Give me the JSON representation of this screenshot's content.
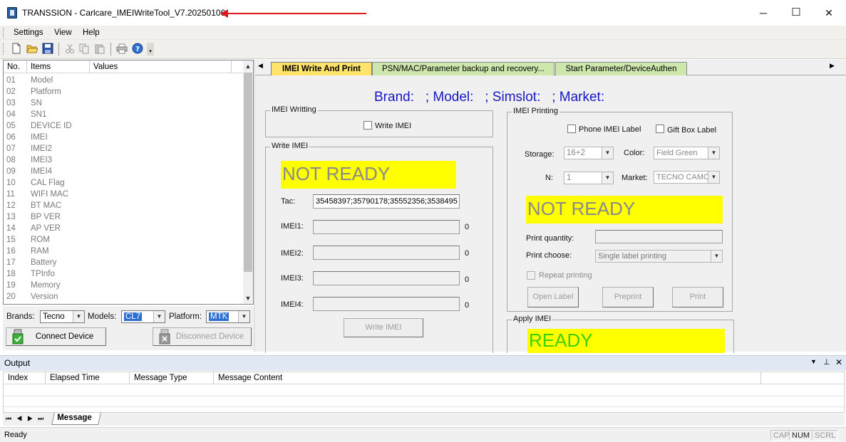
{
  "window": {
    "title": "TRANSSION - Carlcare_IMEIWriteTool_V7.20250106",
    "minimize": "─",
    "maximize": "☐",
    "close": "✕"
  },
  "menu": [
    "Settings",
    "View",
    "Help"
  ],
  "toolbar_icons": [
    "new-file-icon",
    "open-folder-icon",
    "save-icon",
    "cut-icon",
    "copy-icon",
    "paste-icon",
    "print-icon",
    "help-icon"
  ],
  "list": {
    "headers": [
      "No.",
      "Items",
      "Values"
    ],
    "rows": [
      {
        "no": "01",
        "item": "Model"
      },
      {
        "no": "02",
        "item": "Platform"
      },
      {
        "no": "03",
        "item": "SN"
      },
      {
        "no": "04",
        "item": "SN1"
      },
      {
        "no": "05",
        "item": "DEVICE ID"
      },
      {
        "no": "06",
        "item": "IMEI"
      },
      {
        "no": "07",
        "item": "IMEI2"
      },
      {
        "no": "08",
        "item": "IMEI3"
      },
      {
        "no": "09",
        "item": "IMEI4"
      },
      {
        "no": "10",
        "item": "CAL Flag"
      },
      {
        "no": "11",
        "item": "WIFI MAC"
      },
      {
        "no": "12",
        "item": "BT MAC"
      },
      {
        "no": "13",
        "item": "BP VER"
      },
      {
        "no": "14",
        "item": "AP VER"
      },
      {
        "no": "15",
        "item": "ROM"
      },
      {
        "no": "16",
        "item": "RAM"
      },
      {
        "no": "17",
        "item": "Battery"
      },
      {
        "no": "18",
        "item": "TPInfo"
      },
      {
        "no": "19",
        "item": "Memory"
      },
      {
        "no": "20",
        "item": "Version"
      }
    ]
  },
  "device": {
    "brands_label": "Brands:",
    "brands_value": "Tecno",
    "models_label": "Models:",
    "models_value": "CL7",
    "platform_label": "Platform:",
    "platform_value": "MTK",
    "connect": "Connect Device",
    "disconnect": "Disconnect Device"
  },
  "tabs": [
    "IMEI Write And Print",
    "PSN/MAC/Parameter backup and recovery...",
    "Start Parameter/DeviceAuthen"
  ],
  "header_line": "Brand:   ; Model:   ; Simslot:   ; Market:",
  "imei_writing": {
    "group": "IMEI Writting",
    "checkbox": "Write IMEI"
  },
  "write_imei": {
    "group": "Write IMEI",
    "status": "NOT READY",
    "tac_label": "Tac:",
    "tac_value": "35458397;35790178;35552356;3538495",
    "imei_labels": [
      "IMEI1:",
      "IMEI2:",
      "IMEI3:",
      "IMEI4:"
    ],
    "imei_counts": [
      "0",
      "0",
      "0",
      "0"
    ],
    "button": "Write IMEI"
  },
  "imei_printing": {
    "group": "IMEI Printing",
    "phone_label_cb": "Phone IMEI Label",
    "gift_box_cb": "Gift Box Label",
    "storage_label": "Storage:",
    "storage_value": "16+2",
    "color_label": "Color:",
    "color_value": "Field Green",
    "n_label": "N:",
    "n_value": "1",
    "market_label": "Market:",
    "market_value": "TECNO CAMON",
    "status": "NOT READY",
    "print_quantity_label": "Print quantity:",
    "print_choose_label": "Print choose:",
    "print_choose_value": "Single label printing",
    "repeat_printing": "Repeat printing",
    "open_label": "Open Label",
    "preprint": "Preprint",
    "print": "Print"
  },
  "apply_imei": {
    "group": "Apply IMEI",
    "status": "READY"
  },
  "output": {
    "title": "Output",
    "headers": [
      "Index",
      "Elapsed Time",
      "Message Type",
      "Message Content"
    ],
    "tab": "Message"
  },
  "statusbar": {
    "text": "Ready",
    "indicators": [
      "CAP",
      "NUM",
      "SCRL"
    ]
  }
}
